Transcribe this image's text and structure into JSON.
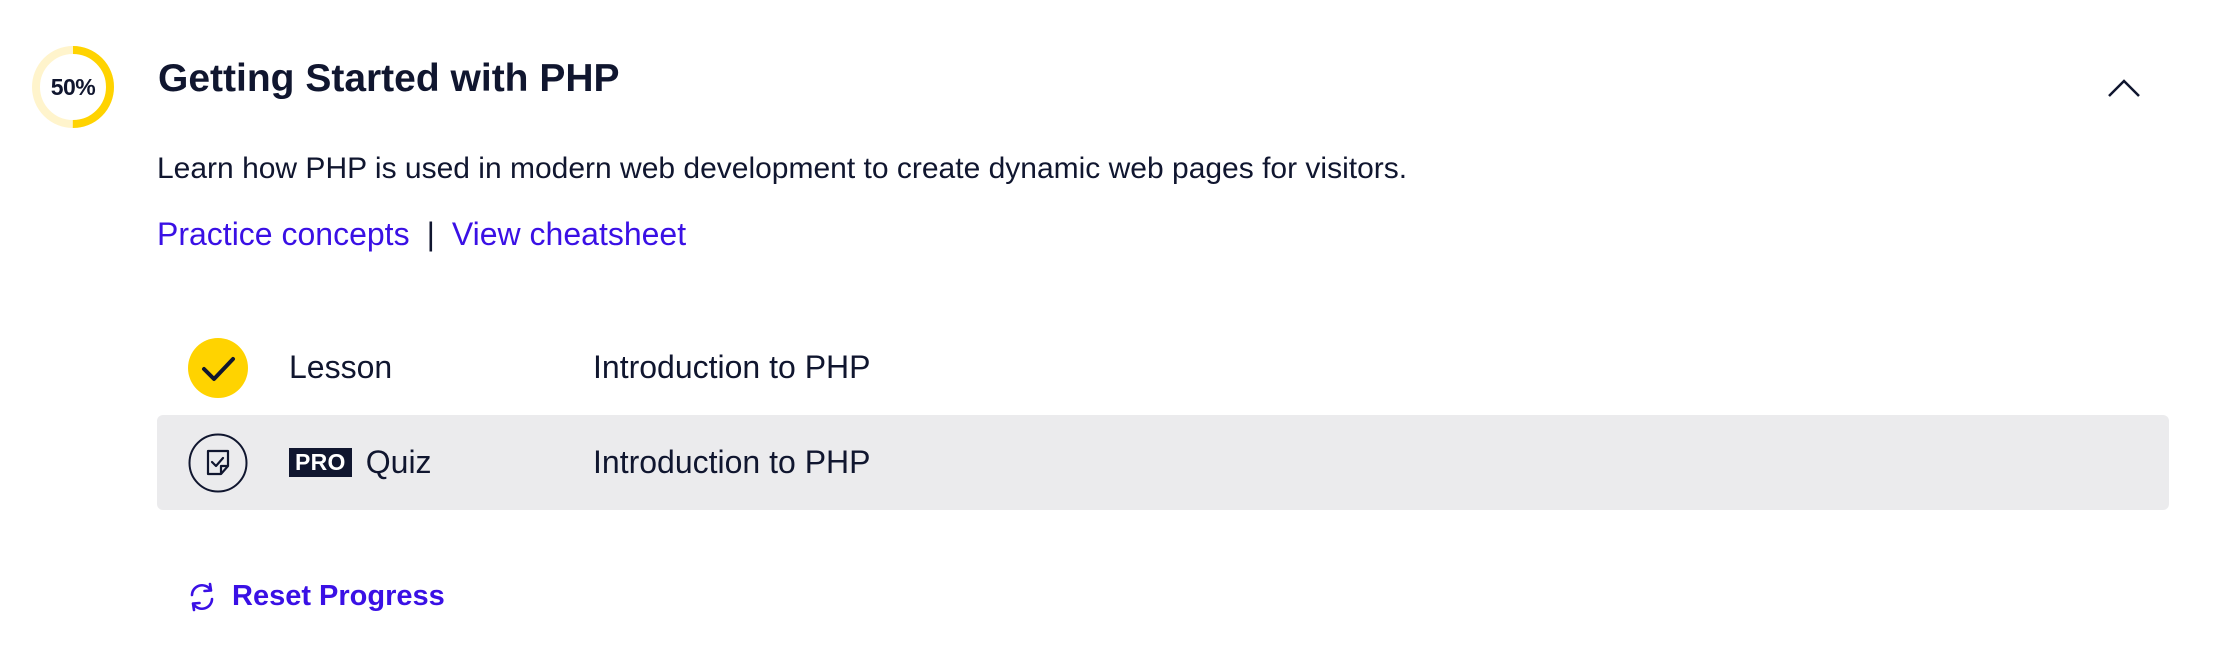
{
  "module": {
    "progress_label": "50%",
    "progress_fraction": 0.5,
    "title": "Getting Started with PHP",
    "description": "Learn how PHP is used in modern web development to create dynamic web pages for visitors.",
    "expanded": true,
    "collapse_icon": "chevron-up-icon"
  },
  "links": {
    "practice": "Practice concepts",
    "separator": "|",
    "cheatsheet": "View cheatsheet"
  },
  "items": [
    {
      "status": "completed",
      "status_icon": "checkmark-icon",
      "type": "Lesson",
      "pro": false,
      "name": "Introduction to PHP"
    },
    {
      "status": "not-started",
      "status_icon": "quiz-icon",
      "type": "Quiz",
      "pro": true,
      "pro_label": "PRO",
      "name": "Introduction to PHP"
    }
  ],
  "reset": {
    "label": "Reset Progress",
    "icon": "refresh-icon"
  },
  "colors": {
    "accent": "#ffd300",
    "accent_light": "#fff4cc",
    "link": "#3a10e5",
    "text": "#10162f",
    "row_highlight": "#ebebed"
  }
}
